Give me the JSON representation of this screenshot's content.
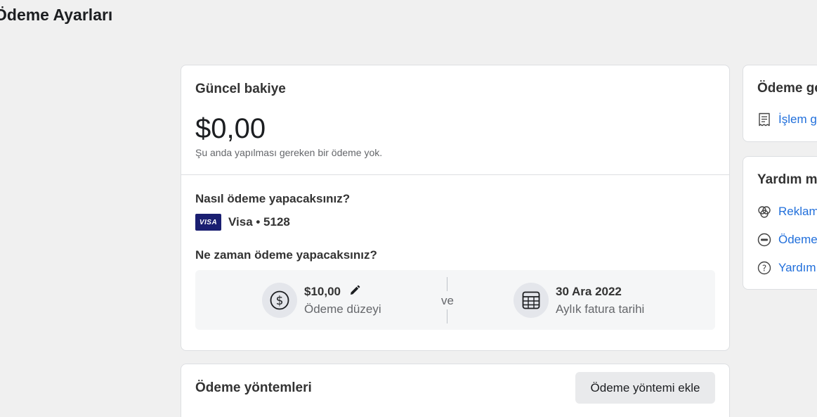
{
  "page": {
    "title": "Ödeme Ayarları"
  },
  "balance": {
    "title": "Güncel bakiye",
    "amount": "$0,00",
    "note": "Şu anda yapılması gereken bir ödeme yok."
  },
  "payment_method": {
    "question": "Nasıl ödeme yapacaksınız?",
    "card_brand": "VISA",
    "card_label": "Visa • 5128"
  },
  "schedule": {
    "question": "Ne zaman ödeme yapacaksınız?",
    "threshold_value": "$10,00",
    "threshold_label": "Ödeme düzeyi",
    "connector": "ve",
    "bill_date_value": "30 Ara 2022",
    "bill_date_label": "Aylık fatura tarihi"
  },
  "methods": {
    "title": "Ödeme yöntemleri",
    "add_button": "Ödeme yöntemi ekle"
  },
  "side_history": {
    "title": "Ödeme ge",
    "link": "İşlem g"
  },
  "side_help": {
    "title": "Yardım m",
    "links": [
      "Reklam",
      "Ödeme",
      "Yardım"
    ]
  }
}
